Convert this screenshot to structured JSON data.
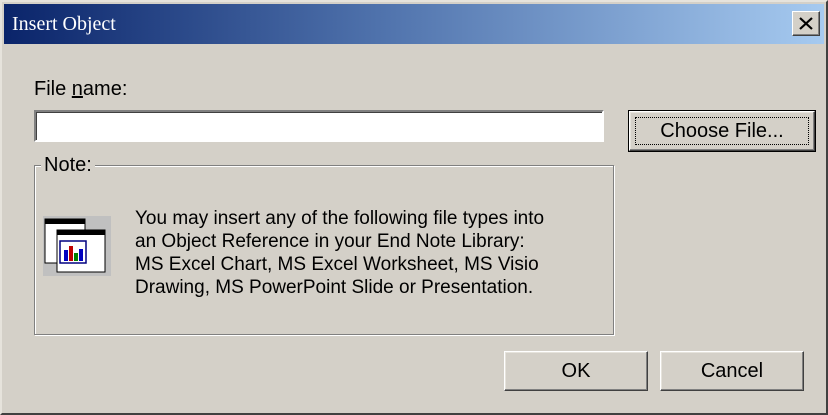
{
  "window": {
    "title": "Insert Object",
    "close_icon": "close-icon"
  },
  "file": {
    "label_prefix": "File ",
    "label_mnemonic": "n",
    "label_suffix": "ame:",
    "value": "",
    "placeholder": ""
  },
  "buttons": {
    "choose_file": "Choose File...",
    "ok": "OK",
    "cancel": "Cancel"
  },
  "note": {
    "legend": "Note:",
    "icon": "object-reference-chart-icon",
    "lines": [
      "You may insert any of the following file types into",
      "an Object Reference in your End Note Library:",
      "MS Excel Chart, MS Excel Worksheet, MS Visio",
      "Drawing, MS PowerPoint Slide or Presentation."
    ]
  },
  "colors": {
    "face": "#d4d0c8",
    "title_start": "#0a246a",
    "title_end": "#a6caf0",
    "title_text": "#ffffff"
  }
}
